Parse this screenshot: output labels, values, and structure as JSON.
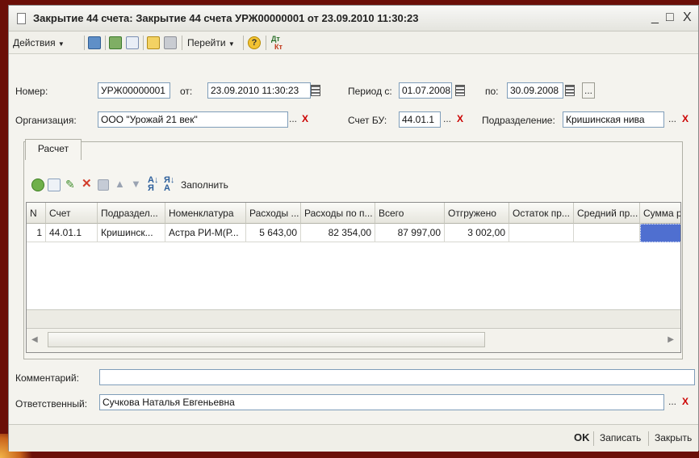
{
  "window": {
    "title": "Закрытие 44 счета: Закрытие 44 счета УРЖ00000001 от 23.09.2010 11:30:23",
    "minimize": "_",
    "maximize": "□",
    "close": "X"
  },
  "toolbar": {
    "actions_label": "Действия",
    "goto_label": "Перейти",
    "help_symbol": "?",
    "dt_kt_top": "Дт",
    "dt_kt_bottom": "Кт"
  },
  "header": {
    "number_label": "Номер:",
    "number_value": "УРЖ00000001",
    "date_label": "от:",
    "date_value": "23.09.2010 11:30:23",
    "period_from_label": "Период с:",
    "period_from_value": "01.07.2008",
    "period_to_label": "по:",
    "period_to_value": "30.09.2008",
    "ellipsis": "...",
    "org_label": "Организация:",
    "org_value": "ООО \"Урожай 21 век\"",
    "account_label": "Счет БУ:",
    "account_value": "44.01.1",
    "subdivision_label": "Подразделение:",
    "subdivision_value": "Кришинская нива",
    "clear": "X"
  },
  "tabs": [
    {
      "label": "Расчет"
    }
  ],
  "table_toolbar": {
    "fill_label": "Заполнить"
  },
  "table": {
    "columns": [
      "N",
      "Счет",
      "Подраздел...",
      "Номенклатура",
      "Расходы ...",
      "Расходы по п...",
      "Всего",
      "Отгружено",
      "Остаток пр...",
      "Средний пр...",
      "Сумма р..."
    ],
    "rows": [
      [
        "1",
        "44.01.1",
        "Кришинск...",
        "Астра РИ-М(Р...",
        "5 643,00",
        "82 354,00",
        "87 997,00",
        "3 002,00",
        "",
        "",
        ""
      ]
    ]
  },
  "footer": {
    "comment_label": "Комментарий:",
    "comment_value": "",
    "responsible_label": "Ответственный:",
    "responsible_value": "Сучкова Наталья Евгеньевна"
  },
  "buttons": {
    "ok": "OK",
    "save": "Записать",
    "close": "Закрыть"
  }
}
